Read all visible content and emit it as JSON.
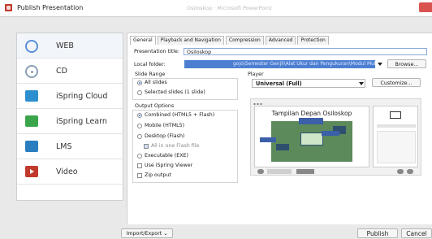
{
  "window": {
    "title": "Publish Presentation",
    "background_title": "Osiloskop · Microsoft PowerPoint"
  },
  "sidebar": {
    "items": [
      {
        "label": "WEB",
        "icon": "globe-icon"
      },
      {
        "label": "CD",
        "icon": "cd-icon"
      },
      {
        "label": "iSpring Cloud",
        "icon": "cloud-icon"
      },
      {
        "label": "iSpring Learn",
        "icon": "learn-icon"
      },
      {
        "label": "LMS",
        "icon": "lms-icon"
      },
      {
        "label": "Video",
        "icon": "video-icon"
      }
    ]
  },
  "tabs": [
    "General",
    "Playback and Navigation",
    "Compression",
    "Advanced",
    "Protection"
  ],
  "general": {
    "presentation_title_label": "Presentation title:",
    "presentation_title_value": "Osiloskop",
    "local_folder_label": "Local folder:",
    "local_folder_value": "gojo\\Semester Genjil\\Alat Ukur dan Pengukuran\\Modul Multimedia",
    "browse_label": "Browse...",
    "slide_range_label": "Slide Range",
    "slide_range_options": [
      "All slides",
      "Selected slides (1 slide)"
    ],
    "output_options_label": "Output Options",
    "output_options": [
      "Combined (HTML5 + Flash)",
      "Mobile (HTML5)",
      "Desktop (Flash)"
    ],
    "all_in_one_flash": "All in one Flash file",
    "executable": "Executable (EXE)",
    "use_viewer": "Use iSpring Viewer",
    "zip_output": "Zip output",
    "player_label": "Player",
    "player_value": "Universal (Full)",
    "customize_label": "Customize...",
    "preview_slide_title": "Tampilan Depan Osiloskop"
  },
  "footer": {
    "import_export_label": "Import/Export",
    "publish_label": "Publish",
    "cancel_label": "Cancel"
  },
  "colors": {
    "accent": "#4d7fd1",
    "close": "#d9534f"
  }
}
